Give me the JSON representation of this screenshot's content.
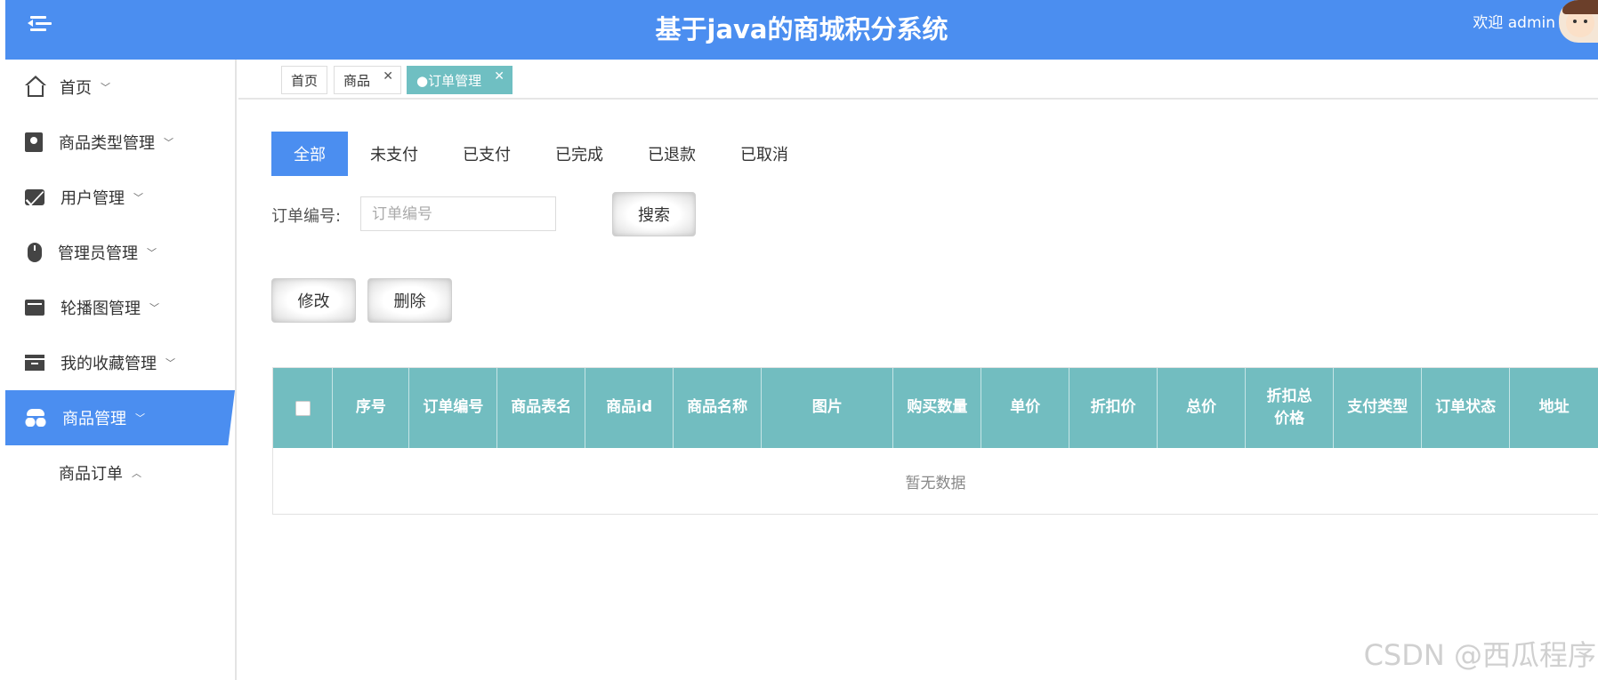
{
  "header": {
    "title": "基于java的商城积分系统",
    "welcome": "欢迎 admin"
  },
  "sidebar": {
    "items": [
      {
        "label": "首页",
        "icon": "home-icon"
      },
      {
        "label": "商品类型管理",
        "icon": "box-icon"
      },
      {
        "label": "用户管理",
        "icon": "mail-icon"
      },
      {
        "label": "管理员管理",
        "icon": "mouse-icon"
      },
      {
        "label": "轮播图管理",
        "icon": "card-icon"
      },
      {
        "label": "我的收藏管理",
        "icon": "archive-icon"
      },
      {
        "label": "商品管理",
        "icon": "user-secret-icon",
        "active": true
      }
    ],
    "sub_items": [
      {
        "label": "商品订单"
      }
    ]
  },
  "tabs": [
    {
      "label": "首页"
    },
    {
      "label": "商品"
    },
    {
      "label": "●订单管理",
      "active": true
    }
  ],
  "status_tabs": [
    "全部",
    "未支付",
    "已支付",
    "已完成",
    "已退款",
    "已取消"
  ],
  "search": {
    "label": "订单编号:",
    "placeholder": "订单编号",
    "button": "搜索"
  },
  "actions": {
    "edit": "修改",
    "delete": "删除"
  },
  "table": {
    "columns": [
      "序号",
      "订单编号",
      "商品表名",
      "商品id",
      "商品名称",
      "图片",
      "购买数量",
      "单价",
      "折扣价",
      "总价",
      "折扣总价格",
      "支付类型",
      "订单状态",
      "地址"
    ],
    "rows": [],
    "empty_text": "暂无数据"
  },
  "watermark": "CSDN @西瓜程序",
  "colors": {
    "primary": "#4b8ef0",
    "table_header": "#72bdc0",
    "active_tab": "#6fbfc2"
  }
}
